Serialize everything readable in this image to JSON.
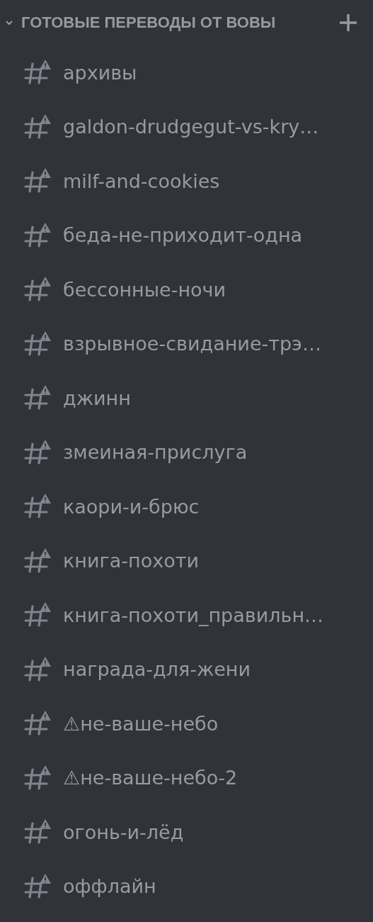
{
  "category": {
    "title": "ГОТОВЫЕ ПЕРЕВОДЫ ОТ ВОВЫ",
    "expanded": true
  },
  "channels": [
    {
      "name": "архивы"
    },
    {
      "name": "galdon-drudgegut-vs-kry…"
    },
    {
      "name": "milf-and-cookies"
    },
    {
      "name": "беда-не-приходит-одна"
    },
    {
      "name": "бессонные-ночи"
    },
    {
      "name": "взрывное-свидание-трэ…"
    },
    {
      "name": "джинн"
    },
    {
      "name": "змеиная-прислуга"
    },
    {
      "name": "каори-и-брюс"
    },
    {
      "name": "книга-похоти"
    },
    {
      "name": "книга-похоти_правильн…"
    },
    {
      "name": "награда-для-жени"
    },
    {
      "name": "⚠не-ваше-небо"
    },
    {
      "name": "⚠не-ваше-небо-2"
    },
    {
      "name": "огонь-и-лёд"
    },
    {
      "name": "оффлайн"
    }
  ]
}
